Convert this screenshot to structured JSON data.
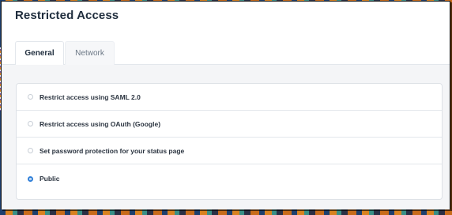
{
  "modal": {
    "title": "Restricted Access"
  },
  "tabs": [
    {
      "label": "General",
      "active": true
    },
    {
      "label": "Network",
      "active": false
    }
  ],
  "options": [
    {
      "label": "Restrict access using SAML 2.0",
      "selected": false
    },
    {
      "label": "Restrict access using OAuth (Google)",
      "selected": false
    },
    {
      "label": "Set password protection for your status page",
      "selected": false
    },
    {
      "label": "Public",
      "selected": true
    }
  ],
  "colors": {
    "accent": "#2f7fd8",
    "title": "#1f2d3d"
  }
}
